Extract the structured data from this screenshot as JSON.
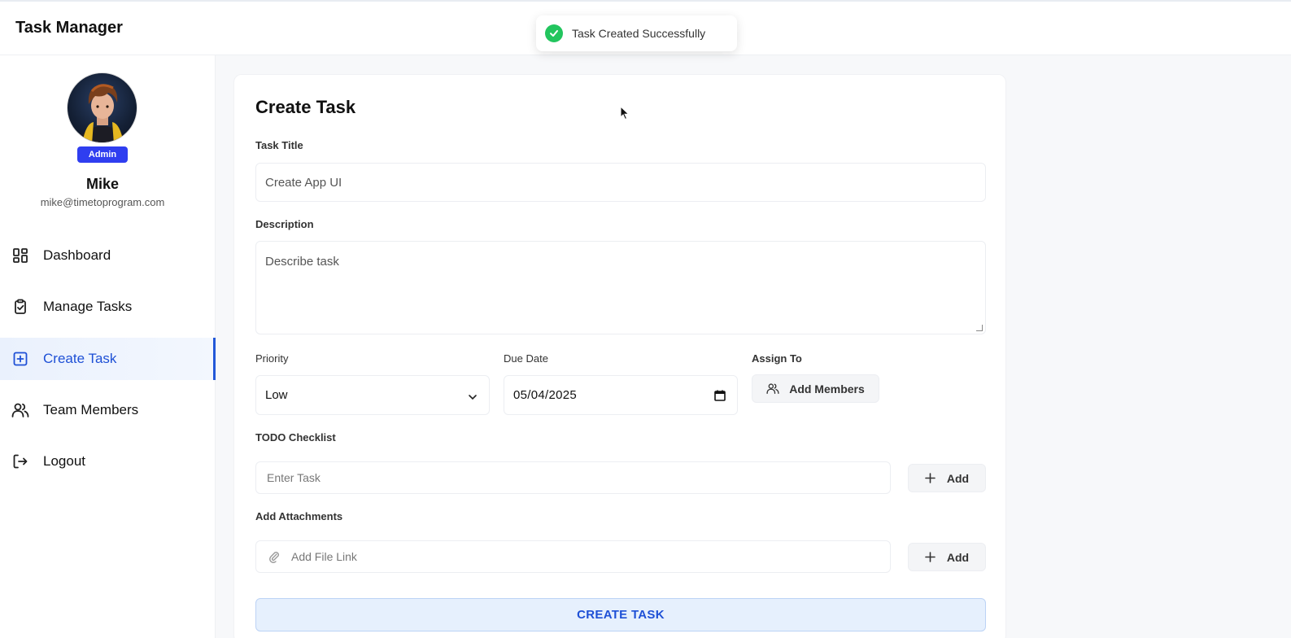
{
  "app": {
    "title": "Task Manager"
  },
  "toast": {
    "message": "Task Created Successfully",
    "icon": "check-circle-icon",
    "color": "#22c55e"
  },
  "user": {
    "role": "Admin",
    "name": "Mike",
    "email": "mike@timetoprogram.com"
  },
  "sidebar": {
    "items": [
      {
        "label": "Dashboard",
        "icon": "dashboard-grid-icon",
        "active": false
      },
      {
        "label": "Manage Tasks",
        "icon": "clipboard-check-icon",
        "active": false
      },
      {
        "label": "Create Task",
        "icon": "plus-square-icon",
        "active": true
      },
      {
        "label": "Team Members",
        "icon": "users-icon",
        "active": false
      },
      {
        "label": "Logout",
        "icon": "logout-icon",
        "active": false
      }
    ]
  },
  "form": {
    "heading": "Create Task",
    "title_label": "Task Title",
    "title_value": "Create App UI",
    "description_label": "Description",
    "description_placeholder": "Describe task",
    "priority_label": "Priority",
    "priority_value": "Low",
    "due_label": "Due Date",
    "due_value": "05/04/2025",
    "assign_label": "Assign To",
    "assign_button": "Add Members",
    "todo_label": "TODO Checklist",
    "todo_placeholder": "Enter Task",
    "todo_add": "Add",
    "attach_label": "Add Attachments",
    "attach_placeholder": "Add File Link",
    "attach_add": "Add",
    "submit": "CREATE TASK"
  },
  "colors": {
    "accent": "#1e50d6",
    "badge": "#2f3ef0"
  }
}
